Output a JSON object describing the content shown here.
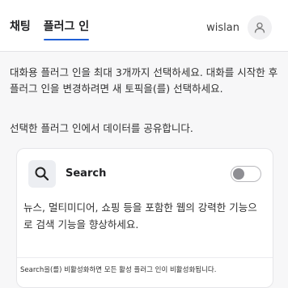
{
  "header": {
    "tabs": [
      {
        "label": "채팅",
        "active": false
      },
      {
        "label": "플러그 인",
        "active": true
      }
    ],
    "username": "wislan",
    "avatar_icon": "user-icon",
    "accent_color": "#1f5fd6"
  },
  "description": "대화용 플러그 인을 최대 3개까지 선택하세요. 대화를 시작한 후 플러그 인을 변경하려면 새 토픽을(를) 선택하세요.",
  "share_text": "선택한 플러그 인에서 데이터를 공유합니다.",
  "plugin": {
    "icon": "search-icon",
    "name": "Search",
    "enabled": false,
    "description": "뉴스, 멀티미디어, 쇼핑 등을 포함한 웹의 강력한 기능으로 검색 기능을 향상하세요.",
    "note": "Search을(를) 비활성화하면 모든 활성 플러그 인이 비활성화됩니다."
  }
}
